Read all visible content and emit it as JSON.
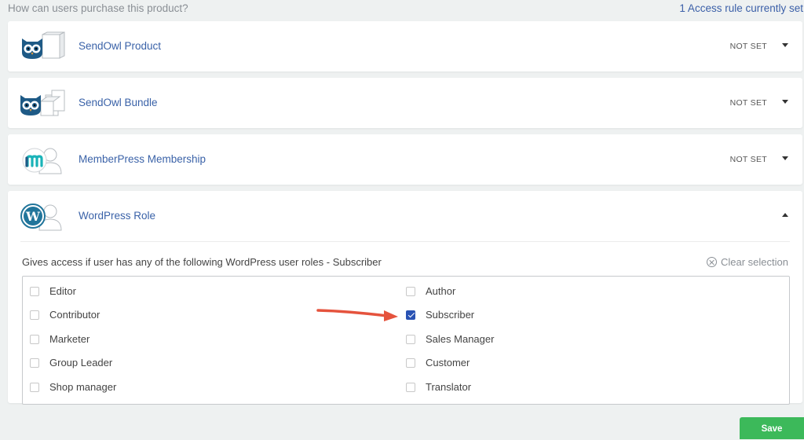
{
  "header": {
    "question": "How can users purchase this product?",
    "rule_count": "1 Access rule currently set"
  },
  "rules": [
    {
      "label": "SendOwl Product",
      "status": "NOT SET",
      "icon": "sendowl-owl-icon"
    },
    {
      "label": "SendOwl Bundle",
      "status": "NOT SET",
      "icon": "sendowl-bundle-icon"
    },
    {
      "label": "MemberPress Membership",
      "status": "NOT SET",
      "icon": "memberpress-icon"
    },
    {
      "label": "WordPress Role",
      "status": "",
      "icon": "wordpress-icon"
    }
  ],
  "wp_role": {
    "description": "Gives access if user has any of the following WordPress user roles - Subscriber",
    "clear_label": "Clear selection",
    "roles_left": [
      {
        "label": "Editor",
        "checked": false
      },
      {
        "label": "Contributor",
        "checked": false
      },
      {
        "label": "Marketer",
        "checked": false
      },
      {
        "label": "Group Leader",
        "checked": false
      },
      {
        "label": "Shop manager",
        "checked": false
      }
    ],
    "roles_right": [
      {
        "label": "Author",
        "checked": false
      },
      {
        "label": "Subscriber",
        "checked": true
      },
      {
        "label": "Sales Manager",
        "checked": false
      },
      {
        "label": "Customer",
        "checked": false
      },
      {
        "label": "Translator",
        "checked": false
      }
    ]
  },
  "footer": {
    "save_label": "Save"
  },
  "colors": {
    "accent": "#3a62a8",
    "save_green": "#3cb95a",
    "checkbox_checked": "#2952b3",
    "arrow_red": "#e5533d"
  }
}
